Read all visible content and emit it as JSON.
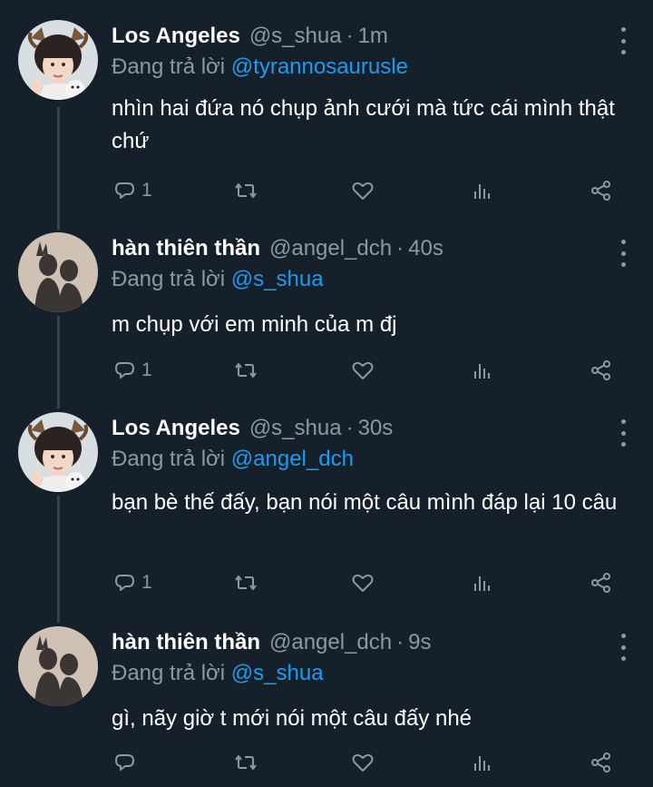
{
  "reply_prefix": "Đang trả lời",
  "tweets": [
    {
      "name": "Los Angeles",
      "handle": "@s_shua",
      "time": "1m",
      "reply_to": "@tyrannosaurusle",
      "text": "nhìn hai đứa nó chụp ảnh cưới mà tức cái mình thật chứ",
      "reply_count": "1",
      "avatar": "photo-avatar-deer-ears"
    },
    {
      "name": "hàn thiên thần",
      "handle": "@angel_dch",
      "time": "40s",
      "reply_to": "@s_shua",
      "text": "m chụp với em minh của m đj",
      "reply_count": "1",
      "avatar": "photo-avatar-shadow"
    },
    {
      "name": "Los Angeles",
      "handle": "@s_shua",
      "time": "30s",
      "reply_to": "@angel_dch",
      "text": "bạn bè thế đấy, bạn nói một câu mình đáp lại 10 câu",
      "reply_count": "1",
      "avatar": "photo-avatar-deer-ears"
    },
    {
      "name": "hàn thiên thần",
      "handle": "@angel_dch",
      "time": "9s",
      "reply_to": "@s_shua",
      "text": "gì, nãy giờ t mới nói một câu đấy nhé",
      "reply_count": "",
      "avatar": "photo-avatar-shadow"
    }
  ],
  "icons": {
    "reply": "reply-icon",
    "retweet": "retweet-icon",
    "like": "heart-icon",
    "views": "analytics-icon",
    "share": "share-icon",
    "more": "more-options-icon"
  },
  "colors": {
    "background": "#15202b",
    "text": "#ffffff",
    "secondary": "#8b98a5",
    "link": "#1d9bf0",
    "thread_line": "#38444d"
  }
}
